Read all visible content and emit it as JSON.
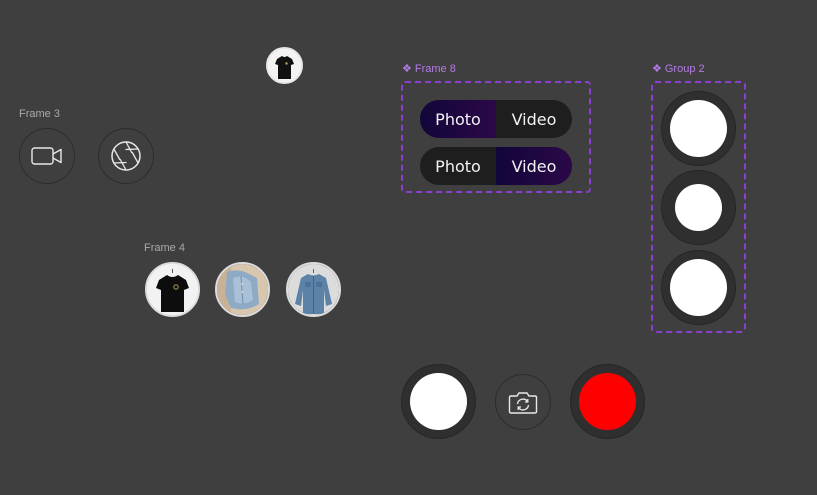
{
  "frames": {
    "frame3_label": "Frame 3",
    "frame4_label": "Frame 4",
    "frame8_label": "Frame 8",
    "group2_label": "Group 2"
  },
  "frame3": {
    "video_icon": "video-camera-icon",
    "aperture_icon": "aperture-icon"
  },
  "frame4": {
    "thumbnails": [
      "black-tshirt",
      "denim-shirt-folded",
      "denim-shirt-hanger"
    ]
  },
  "top_thumbnail": "black-tshirt",
  "frame8": {
    "toggle_photo_active": {
      "photo": "Photo",
      "video": "Video",
      "active": "photo"
    },
    "toggle_video_active": {
      "photo": "Photo",
      "video": "Video",
      "active": "video"
    }
  },
  "controls": {
    "shutter_color": "#ffffff",
    "record_color": "#ff0000",
    "flip_icon": "camera-flip-icon"
  },
  "colors": {
    "background": "#3f3f3f",
    "component_accent": "#8a3fd1",
    "active_segment": "#1a0640"
  }
}
